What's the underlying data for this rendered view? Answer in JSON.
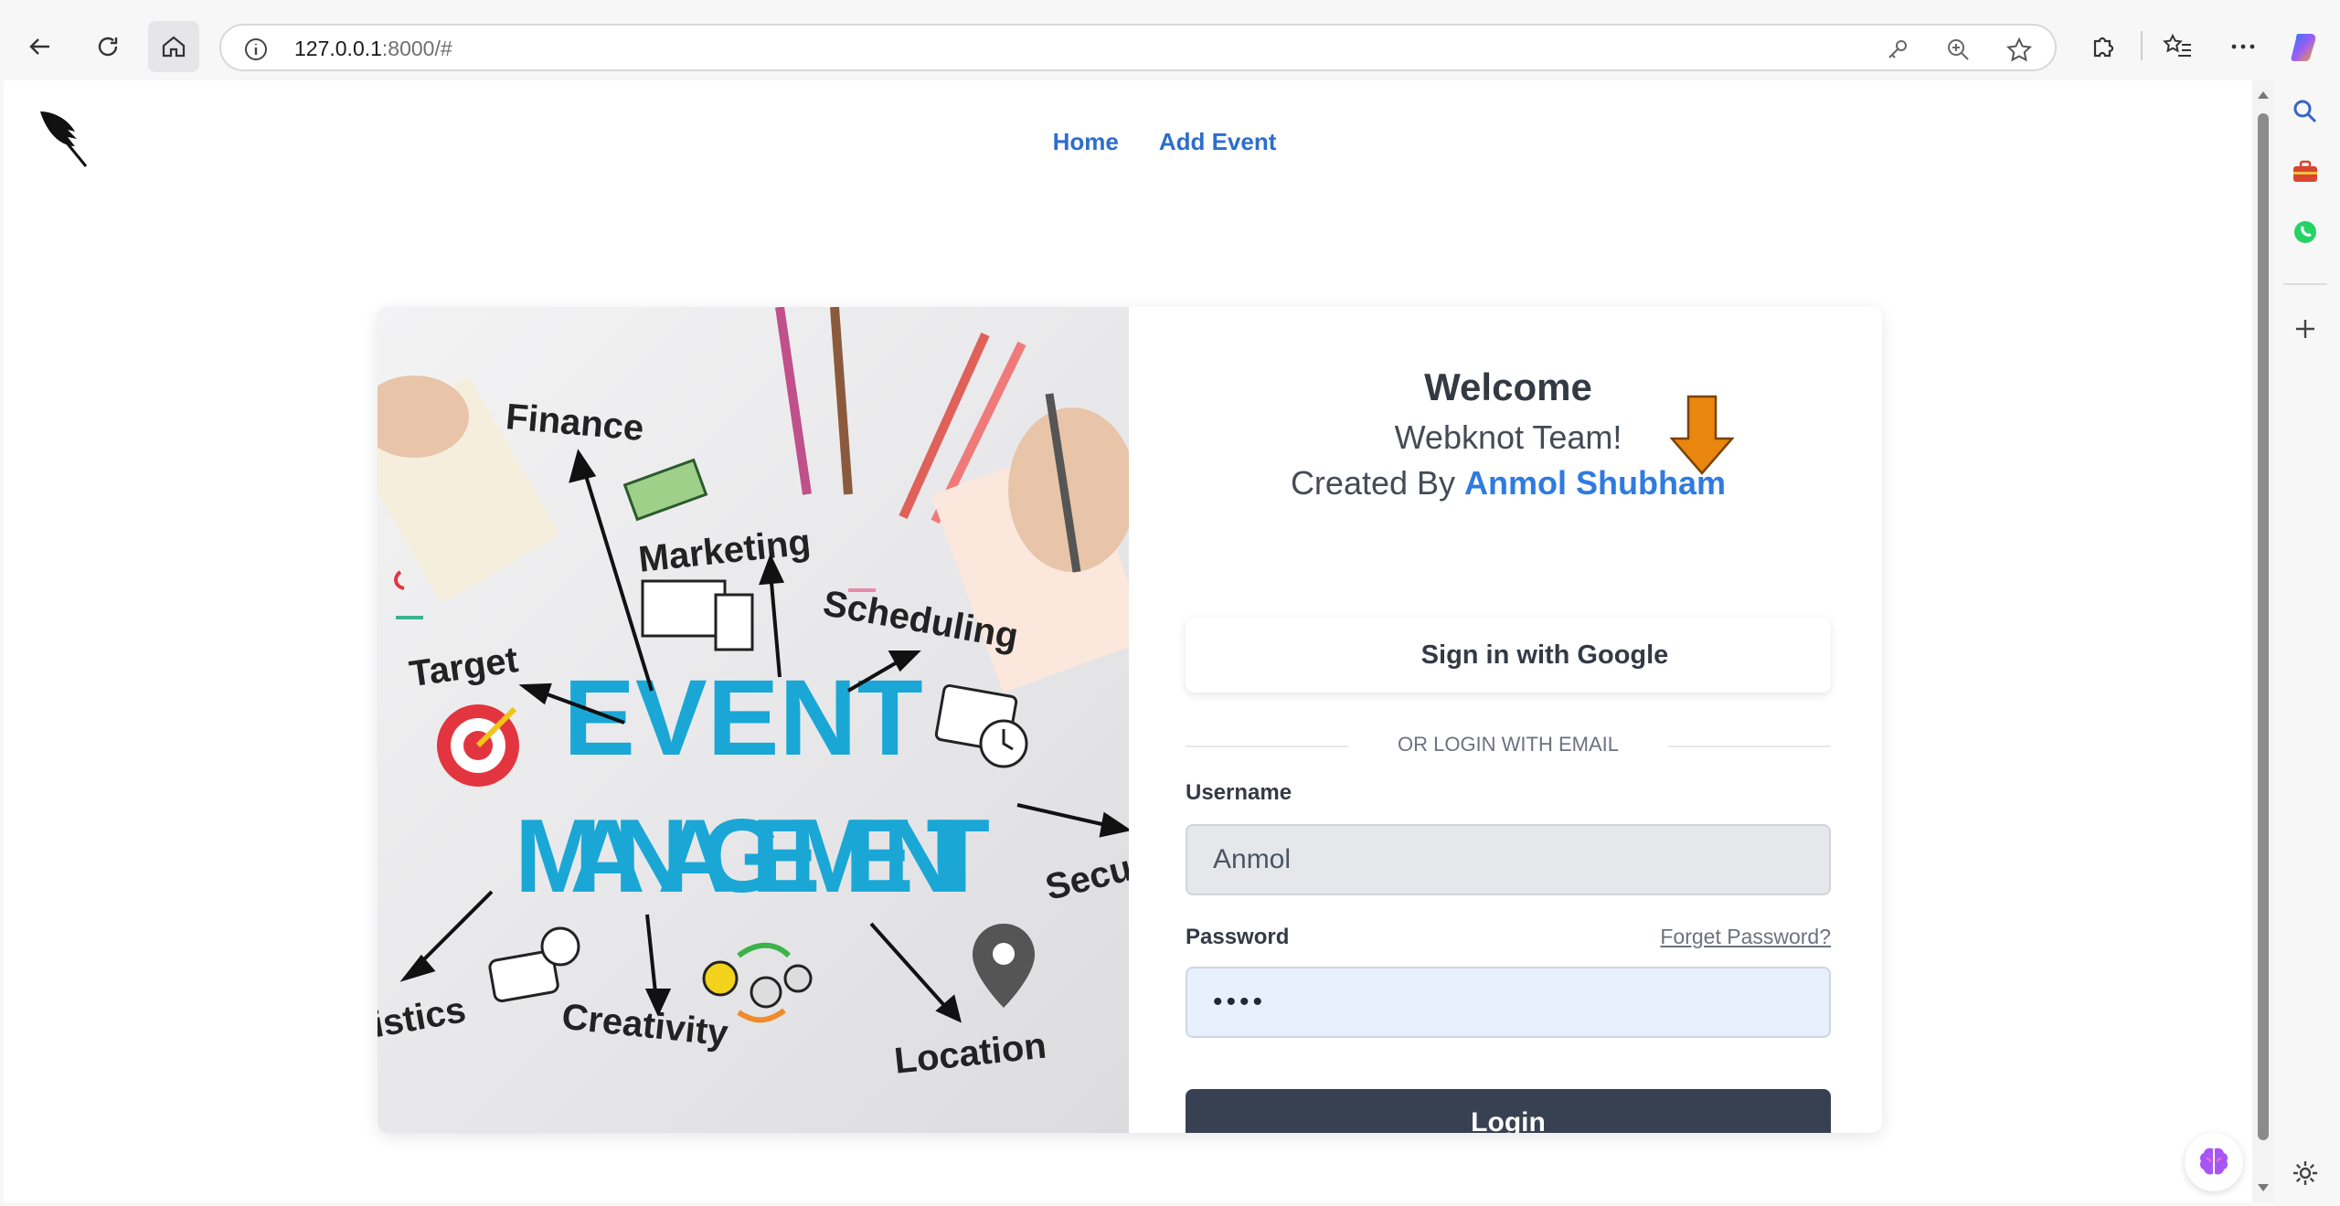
{
  "browser": {
    "url_host": "127.0.0.1",
    "url_rest": ":8000/#"
  },
  "nav": {
    "links": [
      "Home",
      "Add Event"
    ]
  },
  "hero": {
    "title_line1": "EVENT",
    "title_line2": "MANAGEMENT",
    "words": [
      "Finance",
      "Marketing",
      "Scheduling",
      "Target",
      "Secu",
      "istics",
      "Creativity",
      "Location"
    ]
  },
  "login": {
    "welcome": "Welcome",
    "team": "Webknot Team!",
    "created_prefix": "Created By",
    "author": "Anmol Shubham",
    "google_label": "Sign in with Google",
    "divider_label": "OR LOGIN WITH EMAIL",
    "username_label": "Username",
    "username_value": "Anmol",
    "password_label": "Password",
    "forgot_label": "Forget Password?",
    "password_mask": "••••",
    "login_label": "Login"
  },
  "colors": {
    "link": "#2c6ecb",
    "author": "#2f7bdf",
    "login_button": "#374151",
    "annotation_arrow": "#e8860e",
    "hero_title": "#1aa7d6"
  }
}
